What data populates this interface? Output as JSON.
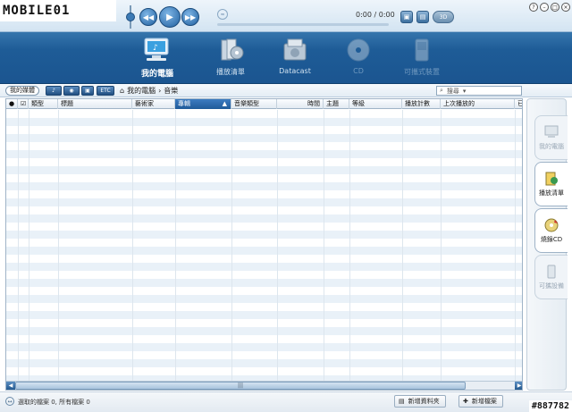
{
  "watermark_top": "MOBILE01",
  "watermark_bottom": "#887782",
  "player": {
    "time": "0:00 / 0:00",
    "mini_btn_label": "3D"
  },
  "nav": [
    {
      "label": "我的電腦",
      "icon": "my-computer-icon",
      "state": "active"
    },
    {
      "label": "播放清單",
      "icon": "playlist-icon",
      "state": "normal"
    },
    {
      "label": "Datacast",
      "icon": "datacast-icon",
      "state": "normal"
    },
    {
      "label": "CD",
      "icon": "cd-icon",
      "state": "disabled"
    },
    {
      "label": "可攜式裝置",
      "icon": "portable-device-icon",
      "state": "disabled"
    }
  ],
  "toolbar": {
    "library_label": "我的媒體",
    "view_etc": "ETC",
    "breadcrumb": [
      "我的電腦",
      "音樂"
    ],
    "search_placeholder": "搜尋"
  },
  "table": {
    "columns": [
      "類型",
      "標題",
      "藝術家",
      "專輯",
      "音樂類型",
      "時間",
      "主題",
      "等級",
      "播放計數",
      "上次播放的",
      "已"
    ],
    "sorted_column": "專輯"
  },
  "side_tabs": [
    {
      "label": "我的電腦",
      "icon": "computer-icon",
      "active": false
    },
    {
      "label": "播放清單",
      "icon": "playlist-icon",
      "active": true
    },
    {
      "label": "燒錄CD",
      "icon": "burn-cd-icon",
      "active": true
    },
    {
      "label": "可攜設備",
      "icon": "portable-icon",
      "active": false
    }
  ],
  "status": {
    "text": "選取的檔案 0, 所有檔案 0",
    "add_folder": "新增資料夾",
    "add_file": "新增檔案"
  }
}
